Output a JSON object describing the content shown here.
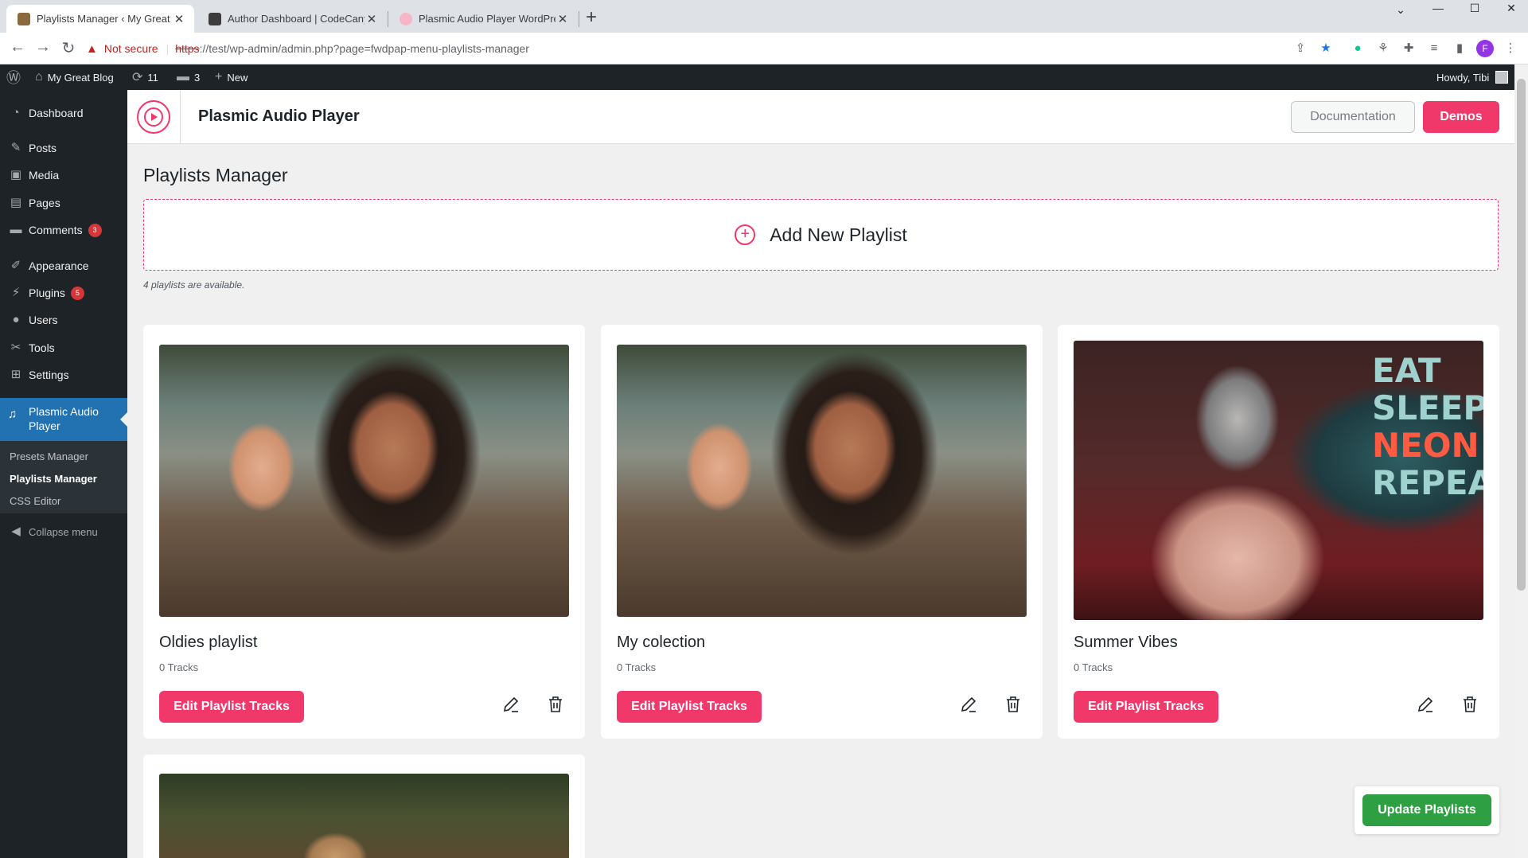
{
  "browser": {
    "tabs": [
      {
        "title": "Playlists Manager ‹ My Great Blo"
      },
      {
        "title": "Author Dashboard | CodeCanyon"
      },
      {
        "title": "Plasmic Audio Player WordPress"
      }
    ],
    "address": {
      "security_label": "Not secure",
      "scheme": "https",
      "url_rest": "://test/wp-admin/admin.php?page=fwdpap-menu-playlists-manager"
    },
    "profile_initial": "F"
  },
  "adminbar": {
    "site_name": "My Great Blog",
    "updates_count": "11",
    "comments_count": "3",
    "new_label": "New",
    "greeting": "Howdy, Tibi"
  },
  "sidebar": {
    "items": [
      {
        "label": "Dashboard"
      },
      {
        "label": "Posts"
      },
      {
        "label": "Media"
      },
      {
        "label": "Pages"
      },
      {
        "label": "Comments",
        "badge": "3"
      },
      {
        "label": "Appearance"
      },
      {
        "label": "Plugins",
        "badge": "5"
      },
      {
        "label": "Users"
      },
      {
        "label": "Tools"
      },
      {
        "label": "Settings"
      }
    ],
    "current": {
      "label": "Plasmic Audio Player"
    },
    "submenu": [
      {
        "label": "Presets Manager"
      },
      {
        "label": "Playlists Manager"
      },
      {
        "label": "CSS Editor"
      }
    ],
    "collapse_label": "Collapse menu"
  },
  "header": {
    "title": "Plasmic Audio Player",
    "documentation_label": "Documentation",
    "demos_label": "Demos"
  },
  "main": {
    "page_title": "Playlists Manager",
    "add_new_label": "Add New Playlist",
    "count_note": "4 playlists are available.",
    "edit_label": "Edit Playlist Tracks",
    "playlists": [
      {
        "title": "Oldies playlist",
        "tracks": "0 Tracks"
      },
      {
        "title": "My colection",
        "tracks": "0 Tracks"
      },
      {
        "title": "Summer Vibes",
        "tracks": "0 Tracks",
        "neon_lines": [
          "EAT",
          "SLEEP",
          "NEON",
          "REPEAT"
        ]
      }
    ],
    "update_label": "Update Playlists"
  },
  "colors": {
    "accent": "#f0386b",
    "wp_admin_bg": "#1d2327",
    "wp_current_menu": "#2271b1",
    "update_green": "#2ea043"
  }
}
